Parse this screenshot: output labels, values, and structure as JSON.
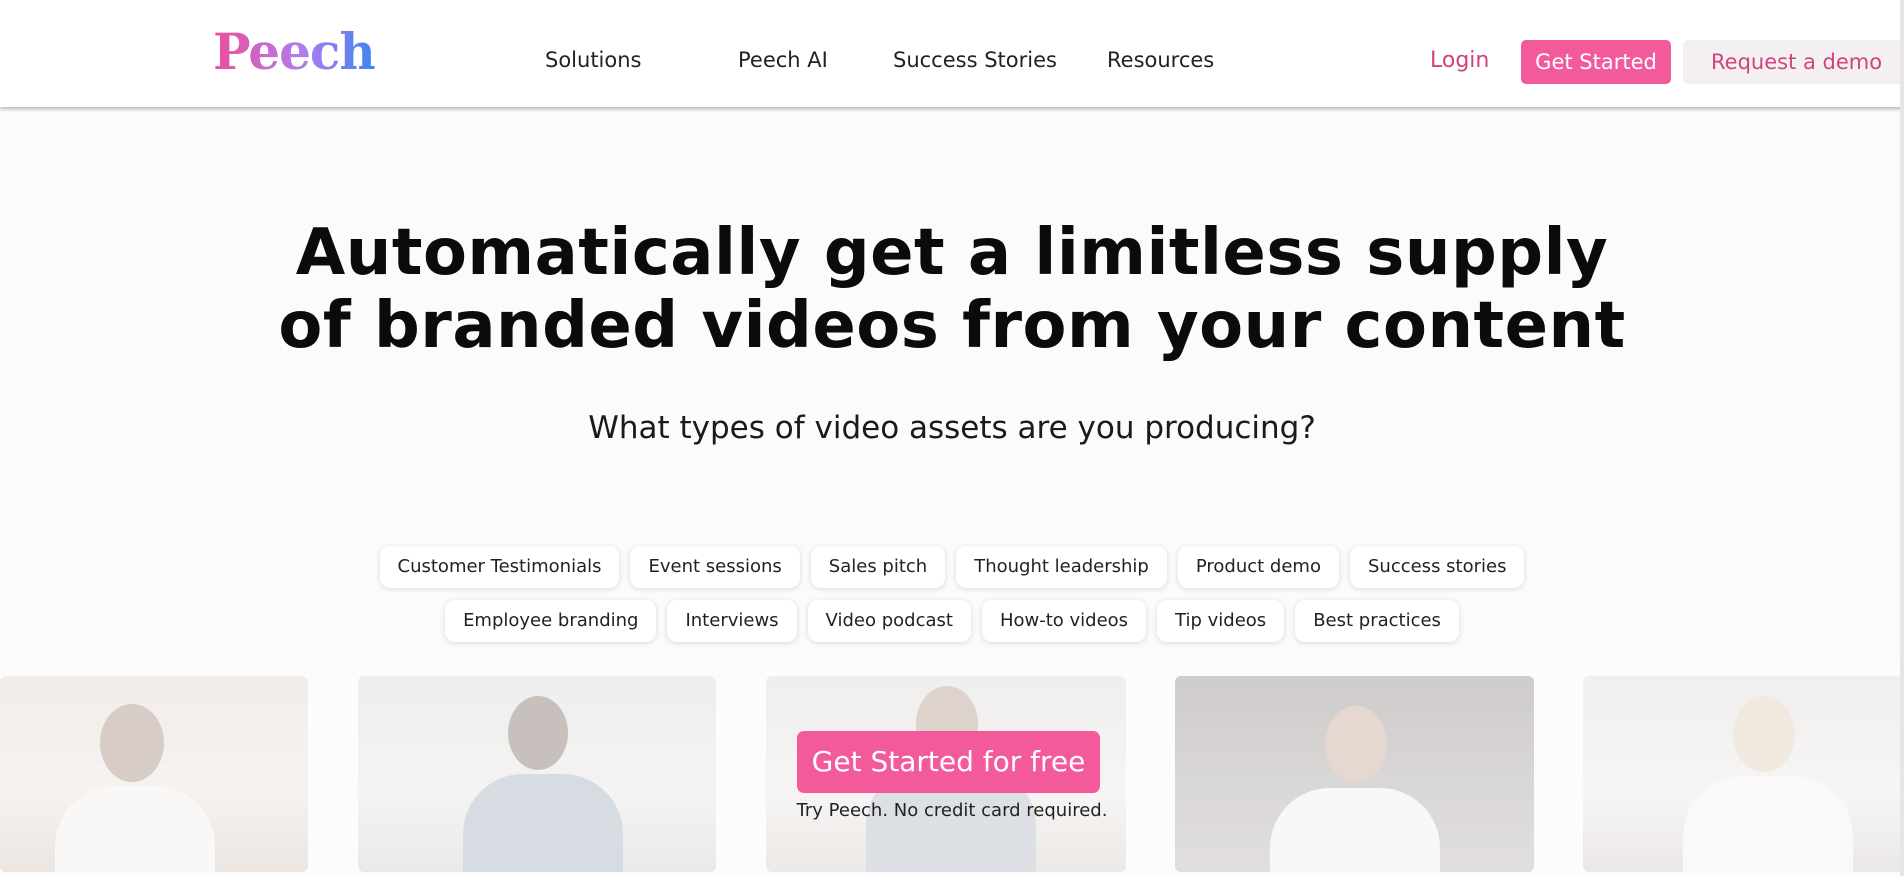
{
  "brand": {
    "logo_text": "Peech"
  },
  "nav": {
    "items": [
      {
        "label": "Solutions"
      },
      {
        "label": "Peech AI"
      },
      {
        "label": "Success Stories"
      },
      {
        "label": "Resources"
      }
    ],
    "login_label": "Login",
    "get_started_label": "Get Started",
    "demo_label": "Request a demo"
  },
  "hero": {
    "title_line1": "Automatically get a limitless supply",
    "title_line2": "of branded videos from your content",
    "subtitle": "What types of video assets are you producing?"
  },
  "chips": {
    "row1": [
      "Customer Testimonials",
      "Event sessions",
      "Sales pitch",
      "Thought leadership",
      "Product demo",
      "Success stories"
    ],
    "row2": [
      "Employee branding",
      "Interviews",
      "Video podcast",
      "How-to videos",
      "Tip videos",
      "Best practices"
    ]
  },
  "cta": {
    "label": "Get Started for free",
    "note": "Try Peech. No credit card required."
  },
  "colors": {
    "accent": "#f35a9b",
    "link": "#d1437f",
    "demo_bg": "#f4f0f2"
  }
}
